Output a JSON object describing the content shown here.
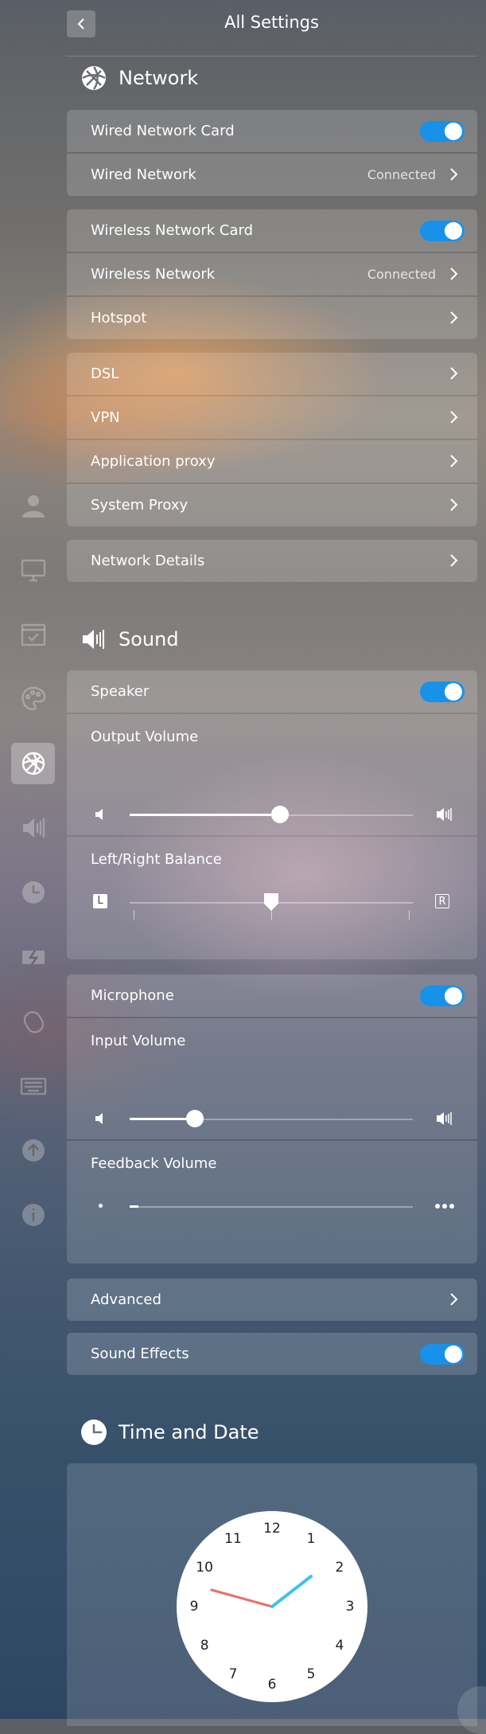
{
  "header": {
    "title": "All Settings"
  },
  "network": {
    "title": "Network",
    "group1": [
      {
        "label": "Wired Network Card",
        "type": "toggle"
      },
      {
        "label": "Wired Network",
        "status": "Connected",
        "type": "link"
      }
    ],
    "group2": [
      {
        "label": "Wireless Network Card",
        "type": "toggle"
      },
      {
        "label": "Wireless Network",
        "status": "Connected",
        "type": "link"
      },
      {
        "label": "Hotspot",
        "type": "link"
      }
    ],
    "group3": [
      {
        "label": "DSL"
      },
      {
        "label": "VPN"
      },
      {
        "label": "Application proxy"
      },
      {
        "label": "System Proxy"
      }
    ],
    "details": {
      "label": "Network Details"
    }
  },
  "sound": {
    "title": "Sound",
    "speaker": {
      "label": "Speaker",
      "enabled": true
    },
    "output_volume": {
      "label": "Output Volume",
      "value": 0.53
    },
    "balance": {
      "label": "Left/Right Balance",
      "left": "L",
      "right": "R",
      "value": 0.5
    },
    "microphone": {
      "label": "Microphone",
      "enabled": true
    },
    "input_volume": {
      "label": "Input Volume",
      "value": 0.23
    },
    "feedback_volume": {
      "label": "Feedback Volume",
      "value": 0.03
    },
    "advanced": {
      "label": "Advanced"
    },
    "sound_effects": {
      "label": "Sound Effects",
      "enabled": true
    }
  },
  "time": {
    "title": "Time and Date",
    "clock_numbers": [
      "12",
      "1",
      "2",
      "3",
      "4",
      "5",
      "6",
      "7",
      "8",
      "9",
      "10",
      "11"
    ]
  },
  "sidebar": [
    "account-icon",
    "display-icon",
    "default-apps-icon",
    "personalization-icon",
    "network-icon",
    "sound-icon",
    "time-icon",
    "power-icon",
    "mouse-icon",
    "keyboard-icon",
    "update-icon",
    "info-icon"
  ],
  "colors": {
    "accent": "#1792e8",
    "minute_hand": "#3cc4e8",
    "hour_hand": "#e8706a"
  }
}
